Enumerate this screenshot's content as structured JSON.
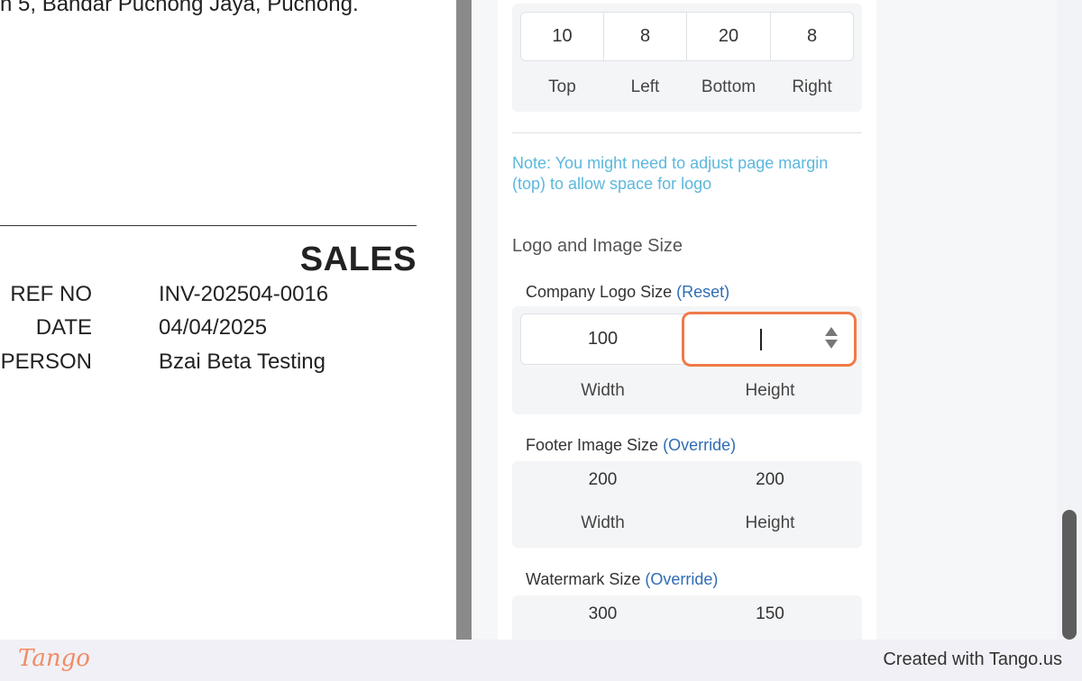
{
  "invoice": {
    "address_fragment": "n 5, Bandar Puchong Jaya, Puchong.",
    "title": "SALES",
    "meta": [
      {
        "label": "REF NO",
        "value": "INV-202504-0016"
      },
      {
        "label": "DATE",
        "value": "04/04/2025"
      },
      {
        "label": "ES PERSON",
        "value": "Bzai Beta Testing"
      }
    ]
  },
  "settings": {
    "margins": {
      "values": [
        "10",
        "8",
        "20",
        "8"
      ],
      "labels": [
        "Top",
        "Left",
        "Bottom",
        "Right"
      ]
    },
    "note": "Note: You might need to adjust page margin (top) to allow space for logo",
    "logo_image_title": "Logo and Image Size",
    "company_logo": {
      "label": "Company Logo Size",
      "action": "(Reset)",
      "width": "100",
      "height": "",
      "width_label": "Width",
      "height_label": "Height"
    },
    "footer_image": {
      "label": "Footer Image Size",
      "action": "(Override)",
      "width": "200",
      "height": "200",
      "width_label": "Width",
      "height_label": "Height"
    },
    "watermark": {
      "label": "Watermark Size",
      "action": "(Override)",
      "width": "300",
      "height": "150"
    }
  },
  "footer": {
    "brand": "Tango",
    "created_text": "Created with Tango.us"
  },
  "colors": {
    "accent_focus": "#f07a4a",
    "link": "#2f6db4",
    "note": "#5bb8dd",
    "brand": "#f08c63"
  }
}
